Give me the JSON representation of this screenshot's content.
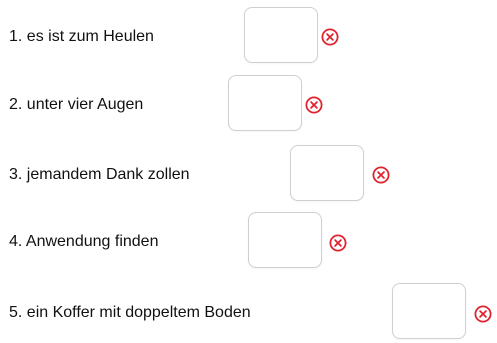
{
  "exercise": {
    "items": [
      {
        "label": "1. es ist zum Heulen",
        "answer": "",
        "status_icon": "wrong-circle-x-icon"
      },
      {
        "label": "2. unter vier Augen",
        "answer": "",
        "status_icon": "wrong-circle-x-icon"
      },
      {
        "label": "3. jemandem Dank zollen",
        "answer": "",
        "status_icon": "wrong-circle-x-icon"
      },
      {
        "label": "4. Anwendung finden",
        "answer": "",
        "status_icon": "wrong-circle-x-icon"
      },
      {
        "label": "5. ein Koffer mit doppeltem Boden",
        "answer": "",
        "status_icon": "wrong-circle-x-icon"
      }
    ],
    "colors": {
      "text": "#111111",
      "box_border": "#cfcfcf",
      "wrong_red": "#e0242f"
    }
  }
}
